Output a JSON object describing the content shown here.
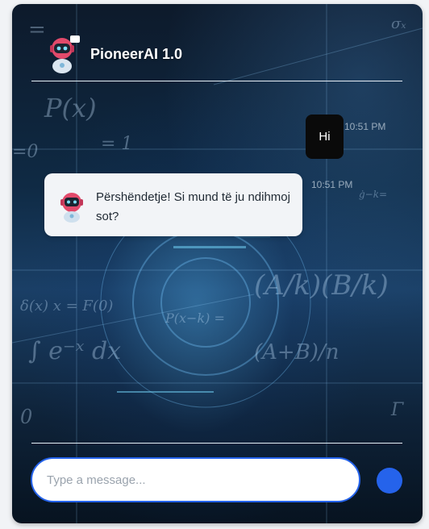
{
  "header": {
    "title": "PioneerAI 1.0",
    "logo_icon": "robot-icon"
  },
  "messages": [
    {
      "sender": "user",
      "text": "Hi",
      "time": "10:51 PM"
    },
    {
      "sender": "bot",
      "text": "Përshëndetje! Si mund të ju ndihmoj sot?",
      "time": "10:51 PM",
      "avatar_icon": "robot-icon"
    }
  ],
  "composer": {
    "placeholder": "Type a message...",
    "send_icon": "send-icon"
  },
  "colors": {
    "accent": "#2563eb",
    "user_bubble": "#0a0a0a",
    "bot_bubble": "#f2f4f7"
  }
}
